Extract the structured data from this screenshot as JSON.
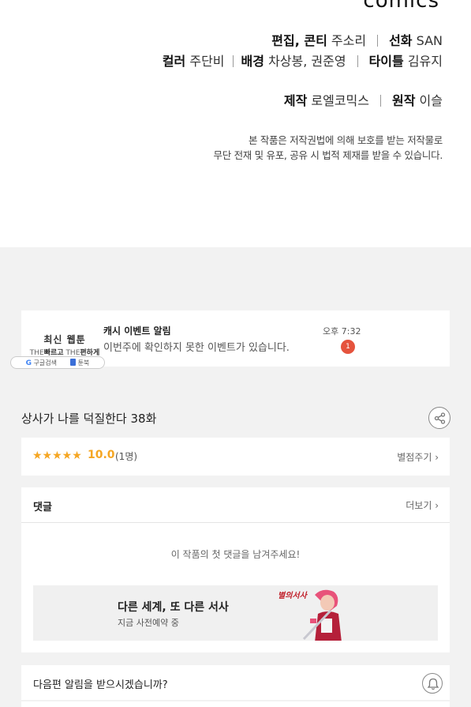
{
  "credits": {
    "brand": "comics",
    "line1": {
      "edit_label": "편집, 콘티",
      "edit_value": "주소리",
      "line_label": "선화",
      "line_value": "SAN"
    },
    "line2": {
      "color_label": "컬러",
      "color_value": "주단비",
      "bg_label": "배경",
      "bg_value": "차상봉, 권준영",
      "typo_label": "타이틀",
      "typo_value": "김유지"
    },
    "line3": {
      "prod_label": "제작",
      "prod_value": "로엘코믹스",
      "orig_label": "원작",
      "orig_value": "이슬"
    },
    "notice_line1": "본 작품은 저작권법에 의해 보호를 받는 저작물로",
    "notice_line2": "무단 전재 및 유포, 공유 시 법적 제재를 받을 수 있습니다."
  },
  "ad": {
    "left_title": "최신 웹툰",
    "left_sub_1": "THE",
    "left_sub_2": "빠르고",
    "left_sub_3": "THE",
    "left_sub_4": "편하게",
    "pill_left": "구글검색",
    "pill_right": "툰북",
    "noti_title": "캐시 이벤트 알림",
    "noti_text": "이번주에 확인하지 못한 이벤트가 있습니다.",
    "time": "오후 7:32",
    "badge": "1"
  },
  "episode": {
    "title": "상사가 나를 덕질한다 38화"
  },
  "rating": {
    "stars": "★★★★★",
    "score": "10.0",
    "votes": "(1명)",
    "rate_link": "별점주기 ›"
  },
  "comments": {
    "title": "댓글",
    "more": "더보기 ›",
    "empty": "이 작품의 첫 댓글을 남겨주세요!"
  },
  "promo": {
    "title": "다른 세계, 또 다른 서사",
    "subtitle": "지금 사전예약 중",
    "logo_text": "별의서사"
  },
  "alert": {
    "text": "다음편 알림을 받으시겠습니까?"
  },
  "colors": {
    "star": "#f5a623",
    "badge": "#e5533d",
    "page_bg": "#f2f2f2"
  }
}
